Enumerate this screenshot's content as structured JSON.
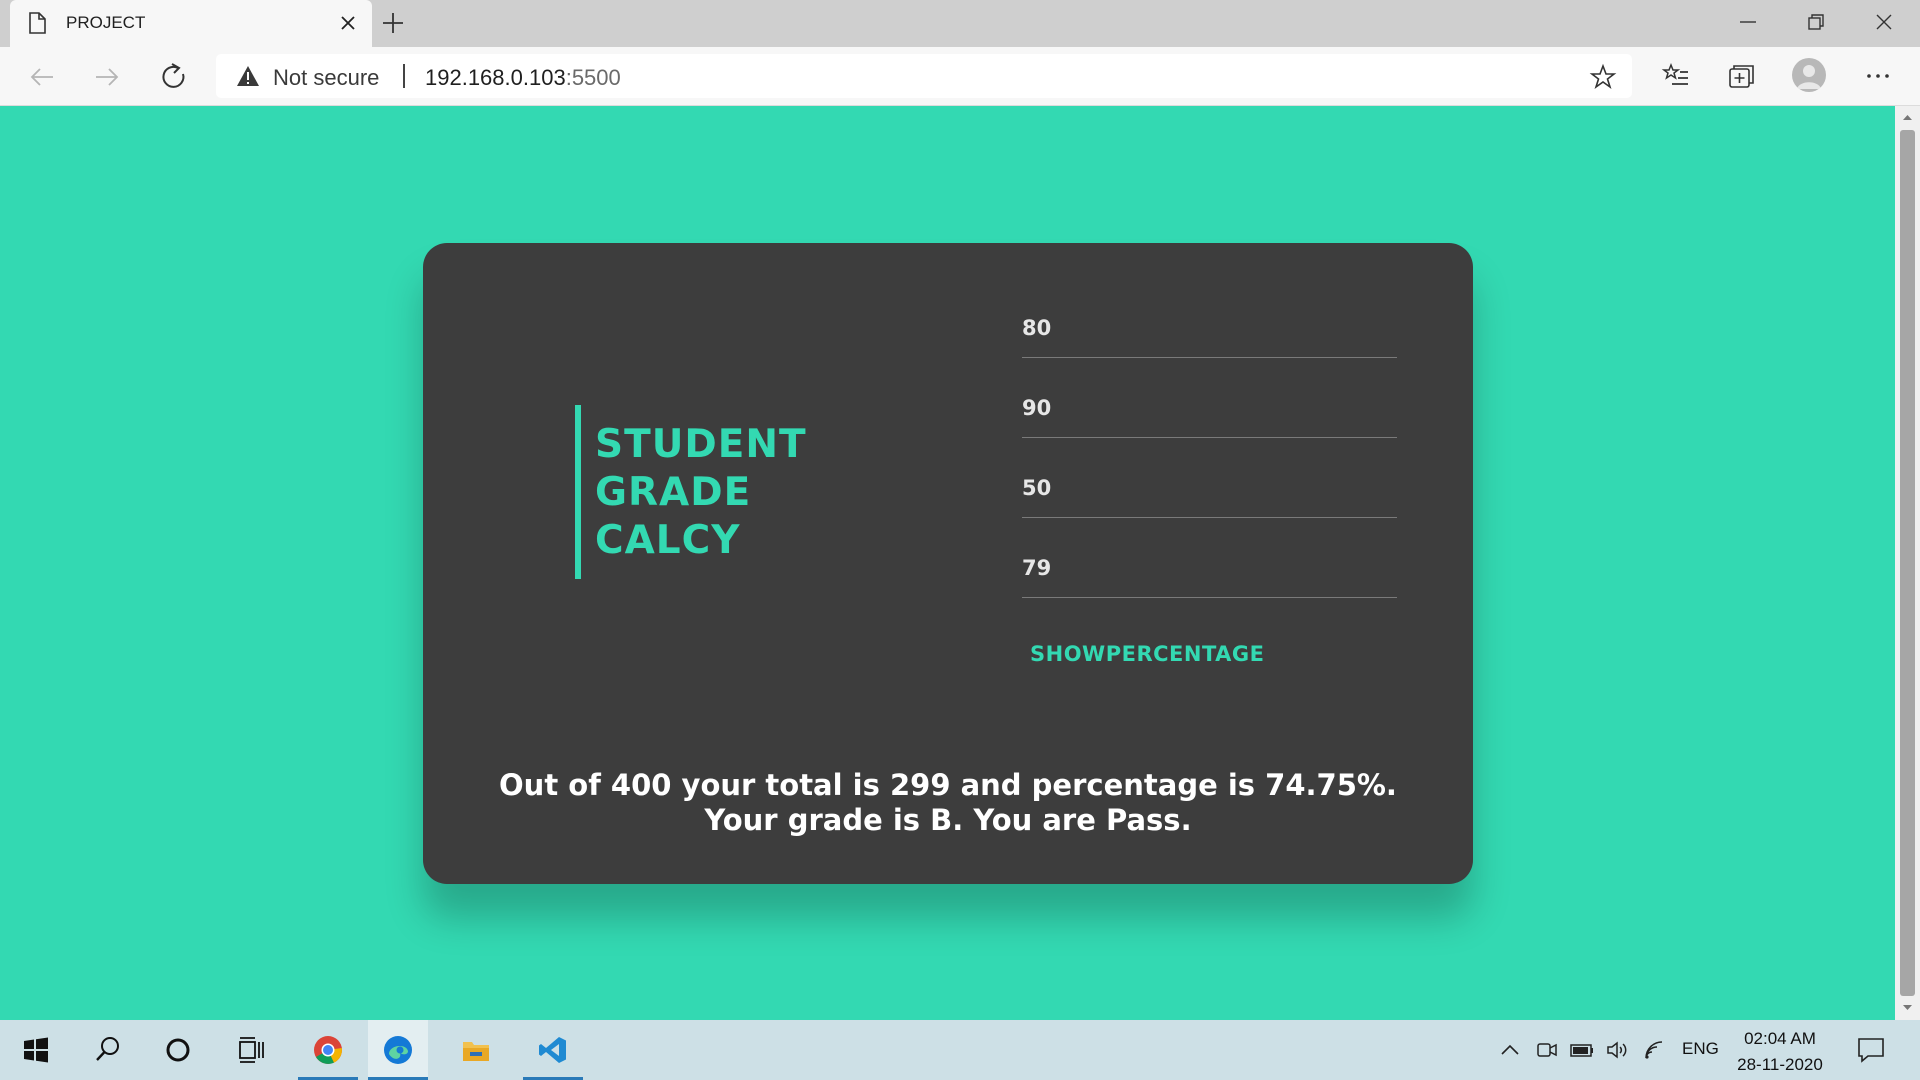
{
  "browser": {
    "tab_title": "PROJECT",
    "security_label": "Not secure",
    "url_host": "192.168.0.103",
    "url_port": ":5500"
  },
  "app": {
    "heading_lines": [
      "STUDENT",
      "GRADE",
      "CALCY"
    ],
    "fields": [
      {
        "value": "80"
      },
      {
        "value": "90"
      },
      {
        "value": "50"
      },
      {
        "value": "79"
      }
    ],
    "button_label": "SHOWPERCENTAGE",
    "result_lines": [
      "Out of 400 your total is 299 and percentage is 74.75%.",
      "Your grade is B. You are Pass."
    ],
    "accent_color": "#33d9b2",
    "card_color": "#3d3d3d"
  },
  "taskbar": {
    "language": "ENG",
    "time": "02:04 AM",
    "date": "28-11-2020"
  }
}
